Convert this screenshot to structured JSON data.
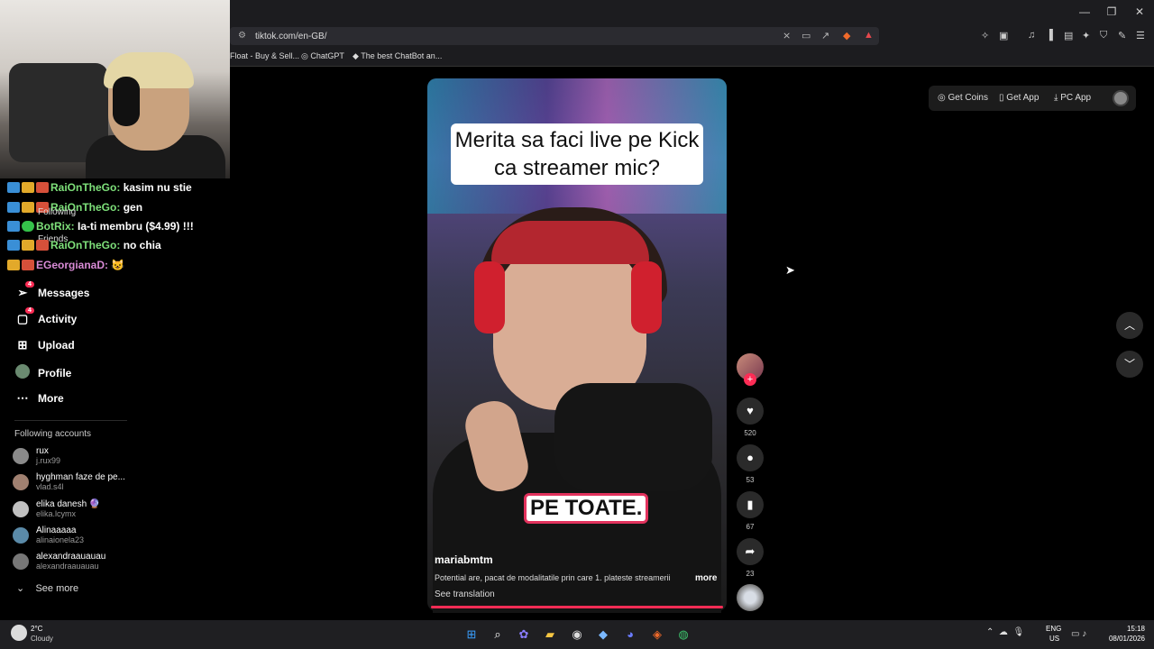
{
  "browser": {
    "url": "tiktok.com/en-GB/",
    "window_controls": [
      "—",
      "❐",
      "✕"
    ],
    "bookmarks": [
      "Float - Buy & Sell...",
      "ChatGPT",
      "The best ChatBot an..."
    ]
  },
  "stream_chat": [
    {
      "user": "RaiOnTheGo:",
      "msg": "kasim nu stie"
    },
    {
      "user": "RaiOnTheGo:",
      "msg": "gen"
    },
    {
      "user": "BotRix:",
      "msg": "Ia-ti membru ($4.99) !!!"
    },
    {
      "user": "RaiOnTheGo:",
      "msg": "no chia"
    },
    {
      "user": "EGeorgianaD:",
      "msg": ""
    }
  ],
  "sidebar": {
    "hidden_items": [
      "Following",
      "Friends"
    ],
    "nav": [
      {
        "label": "Messages",
        "badge": "4"
      },
      {
        "label": "Activity",
        "badge": "4"
      },
      {
        "label": "Upload",
        "badge": ""
      },
      {
        "label": "Profile",
        "badge": ""
      },
      {
        "label": "More",
        "badge": ""
      }
    ],
    "following_header": "Following accounts",
    "accounts": [
      {
        "name": "rux",
        "handle": "j.rux99",
        "color": "#8a8a8a"
      },
      {
        "name": "hyghman faze de pe...",
        "handle": "vlad.s4l",
        "color": "#a08070"
      },
      {
        "name": "elika danesh 🔮",
        "handle": "elika.lcymx",
        "color": "#c0c0c0"
      },
      {
        "name": "Alinaaaaa",
        "handle": "alinaionela23",
        "color": "#5a8aa8"
      },
      {
        "name": "alexandraauauau",
        "handle": "alexandraauauau",
        "color": "#777777"
      }
    ],
    "see_more": "See more"
  },
  "header_right": {
    "get_coins": "Get Coins",
    "get_app": "Get App",
    "pc_app": "PC App"
  },
  "video": {
    "title_overlay": "Merita sa faci live pe Kick ca streamer mic?",
    "caption": "PE TOATE.",
    "username": "mariabmtm",
    "description": "Potential are, pacat de modalitatile prin care 1. plateste streamerii",
    "more": "more",
    "see_translation": "See translation",
    "likes": "520",
    "comments": "53",
    "saves": "67",
    "shares": "23"
  },
  "taskbar": {
    "weather_temp": "2°C",
    "weather_desc": "Cloudy",
    "lang_line1": "ENG",
    "lang_line2": "US",
    "time": "15:18",
    "date": "08/01/2026"
  },
  "colors": {
    "accent": "#fe2c55",
    "chat_user": "#7ee07a"
  }
}
